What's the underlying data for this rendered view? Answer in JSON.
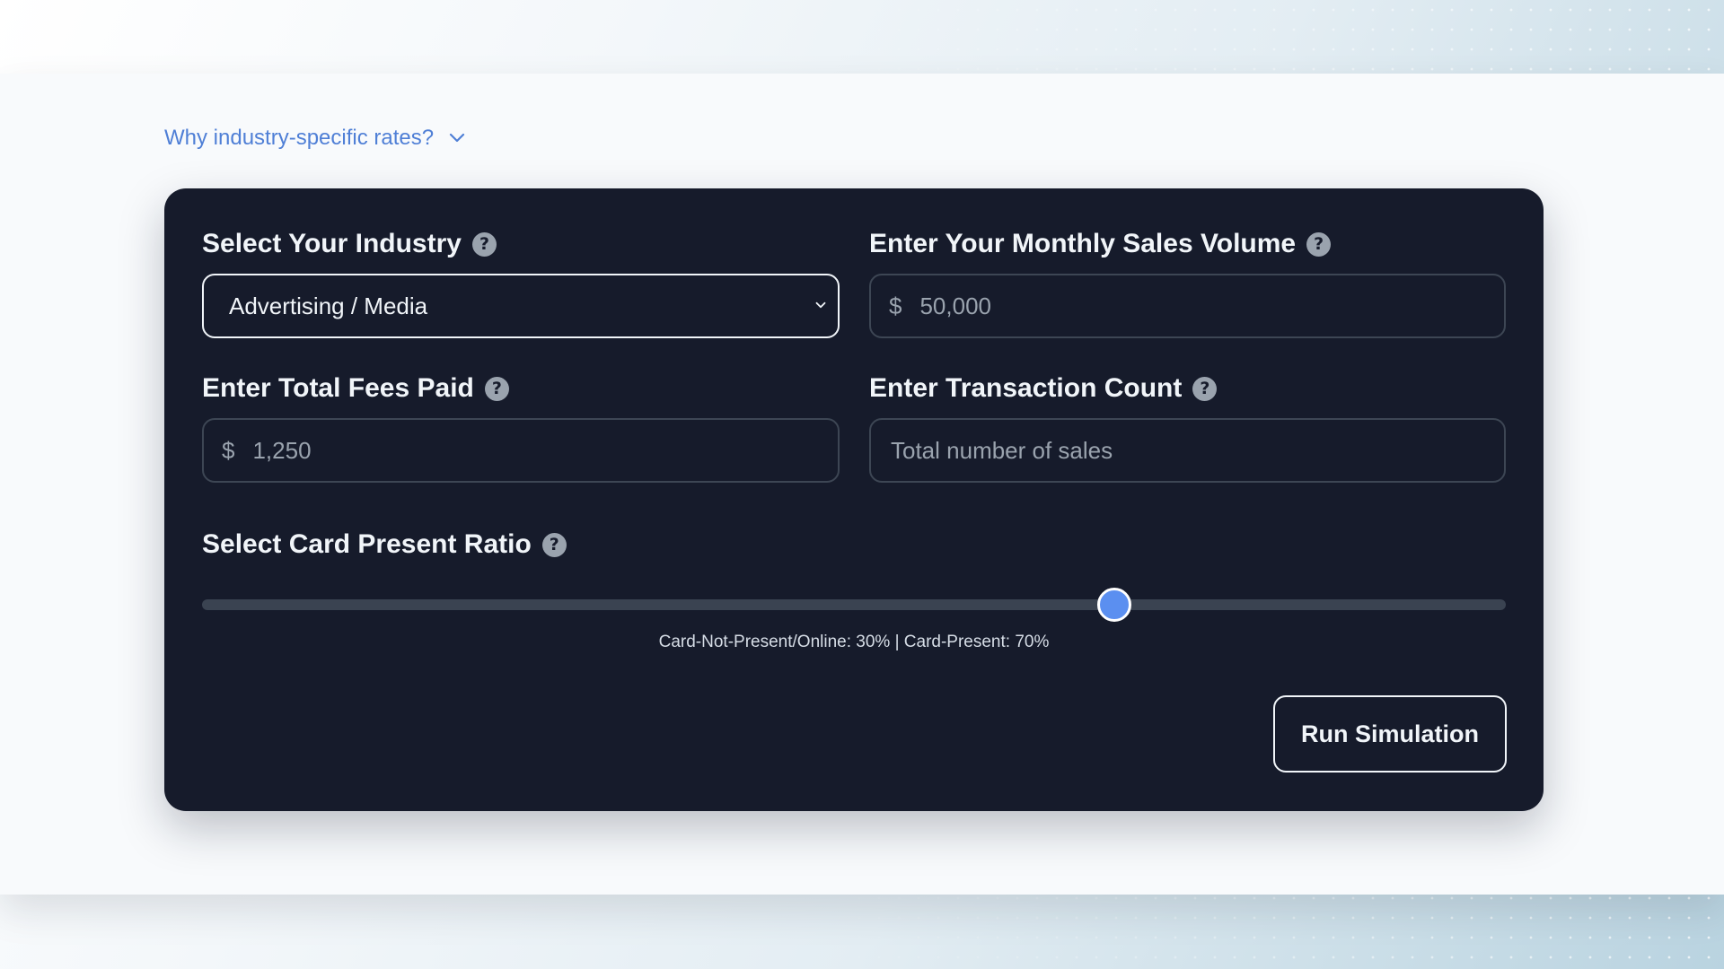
{
  "disclosure": {
    "label": "Why industry-specific rates?",
    "icon": "chevron-down-icon"
  },
  "form": {
    "industry": {
      "label": "Select Your Industry",
      "value": "Advertising / Media"
    },
    "monthly_sales": {
      "label": "Enter Your Monthly Sales Volume",
      "currency": "$",
      "placeholder": "50,000"
    },
    "total_fees": {
      "label": "Enter Total Fees Paid",
      "currency": "$",
      "placeholder": "1,250"
    },
    "transaction_count": {
      "label": "Enter Transaction Count",
      "placeholder": "Total number of sales"
    },
    "card_present": {
      "label": "Select Card Present Ratio",
      "value_percent": 70,
      "readout": "Card-Not-Present/Online: 30% | Card-Present: 70%"
    },
    "help_icon": "?",
    "submit_label": "Run Simulation"
  },
  "colors": {
    "accent": "#5b8ff0",
    "link": "#4f7fd6",
    "card_bg": "#161b2b"
  }
}
